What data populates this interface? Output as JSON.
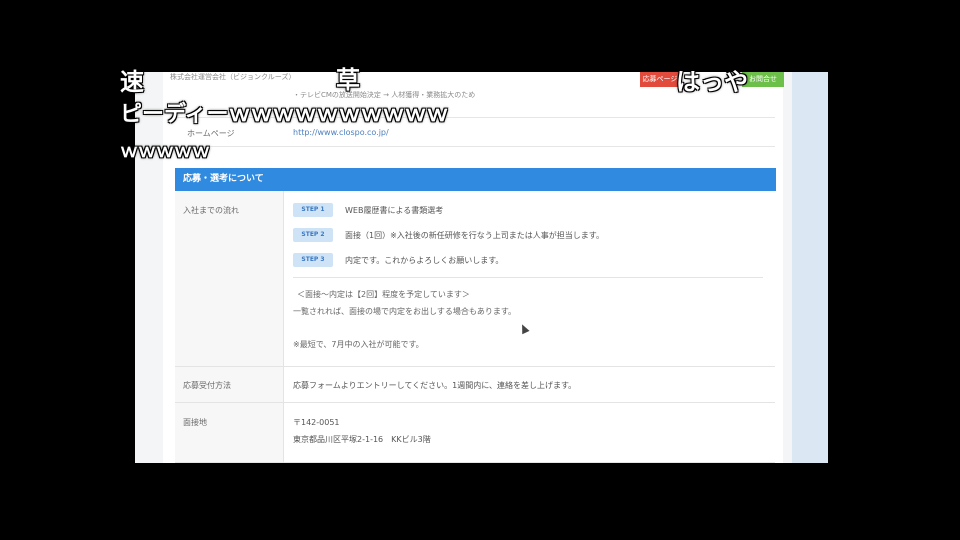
{
  "comments": {
    "c1": "速",
    "c2": "草",
    "c3": "はっや",
    "c4": "ピーディーｗｗｗｗｗｗｗｗｗｗ",
    "c5": "ｗｗｗｗｗ"
  },
  "site": {
    "top_text": "株式会社運営会社（ビジョンクルーズ）",
    "top_text2": "・テレビCMの放送開始決定 → 人材獲得・業務拡大のため",
    "entry_button": "応募ページ",
    "contact_button": "お問合せ"
  },
  "homepage_row": {
    "label": "ホームページ",
    "value": "http://www.clospo.co.jp/"
  },
  "section": {
    "title": "応募・選考について"
  },
  "flow": {
    "label": "入社までの流れ",
    "steps": [
      {
        "badge": "STEP 1",
        "text": "WEB履歴書による書類選考"
      },
      {
        "badge": "STEP 2",
        "text": "面接（1回）※入社後の新任研修を行なう上司または人事が担当します。"
      },
      {
        "badge": "STEP 3",
        "text": "内定です。これからよろしくお願いします。"
      }
    ],
    "note1": "＜面接～内定は【2回】程度を予定しています＞",
    "note2": "一覧されれば、面接の場で内定をお出しする場合もあります。",
    "note3": "※最短で、7月中の入社が可能です。"
  },
  "apply_method": {
    "label": "応募受付方法",
    "value": "応募フォームよりエントリーしてください。1週間内に、連絡を差し上げます。"
  },
  "location": {
    "label": "面接地",
    "zip": "〒142-0051",
    "address": "東京都品川区平塚2-1-16　KKビル3階"
  }
}
